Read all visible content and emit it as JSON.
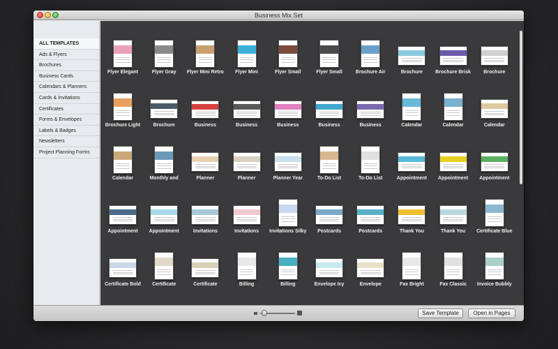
{
  "window": {
    "title": "Business Mix Set"
  },
  "sidebar": {
    "items": [
      {
        "label": "ALL TEMPLATES",
        "active": true
      },
      {
        "label": "Ads & Flyers"
      },
      {
        "label": "Brochures"
      },
      {
        "label": "Business Cards"
      },
      {
        "label": "Calendars & Planners"
      },
      {
        "label": "Cards & Invitations"
      },
      {
        "label": "Certificates"
      },
      {
        "label": "Forms & Envelopes"
      },
      {
        "label": "Labels & Badges"
      },
      {
        "label": "Newsletters"
      },
      {
        "label": "Project Planning Forms"
      }
    ]
  },
  "templates": [
    {
      "label": "Flyer Elegant",
      "shape": "portrait",
      "accent": "#e9a0b8"
    },
    {
      "label": "Flyer Gray",
      "shape": "portrait",
      "accent": "#8a8a8a"
    },
    {
      "label": "Flyer Mini Retro",
      "shape": "portrait",
      "accent": "#c8a070"
    },
    {
      "label": "Flyer Mini",
      "shape": "portrait",
      "accent": "#3db0d8"
    },
    {
      "label": "Flyer Small",
      "shape": "portrait",
      "accent": "#7a4a3a"
    },
    {
      "label": "Flyer Small",
      "shape": "portrait",
      "accent": "#4a4a4a"
    },
    {
      "label": "Brochure Air",
      "shape": "portrait",
      "accent": "#6aa0c8"
    },
    {
      "label": "Brochure",
      "shape": "landscape",
      "accent": "#8ac8e0"
    },
    {
      "label": "Brochure Brisk",
      "shape": "landscape",
      "accent": "#6a5aa8"
    },
    {
      "label": "Brochure",
      "shape": "landscape",
      "accent": "#d0d0d0"
    },
    {
      "label": "Brochure Light",
      "shape": "portrait",
      "accent": "#e8a060"
    },
    {
      "label": "Brochure",
      "shape": "landscape",
      "accent": "#4a5a68"
    },
    {
      "label": "Business",
      "shape": "card",
      "accent": "#d84040"
    },
    {
      "label": "Business",
      "shape": "card",
      "accent": "#5a5a5a"
    },
    {
      "label": "Business",
      "shape": "card",
      "accent": "#e080c0"
    },
    {
      "label": "Business",
      "shape": "card",
      "accent": "#40a8d0"
    },
    {
      "label": "Business",
      "shape": "card",
      "accent": "#7a6ab0"
    },
    {
      "label": "Calendar",
      "shape": "portrait",
      "accent": "#68b8d8"
    },
    {
      "label": "Calendar",
      "shape": "portrait",
      "accent": "#7ab0d0"
    },
    {
      "label": "Calendar",
      "shape": "landscape",
      "accent": "#e0c8a0"
    },
    {
      "label": "Calendar",
      "shape": "portrait",
      "accent": "#c8a878"
    },
    {
      "label": "Monthly and",
      "shape": "portrait",
      "accent": "#6a9ab8"
    },
    {
      "label": "Planner",
      "shape": "landscape",
      "accent": "#e8d0b0"
    },
    {
      "label": "Planner",
      "shape": "landscape",
      "accent": "#d8d0c0"
    },
    {
      "label": "Planner Year",
      "shape": "landscape",
      "accent": "#c8e0f0"
    },
    {
      "label": "To-Do List",
      "shape": "portrait",
      "accent": "#d8b890"
    },
    {
      "label": "To-Do List",
      "shape": "portrait",
      "accent": "#e0e0e0"
    },
    {
      "label": "Appointment",
      "shape": "landscape",
      "accent": "#58b8d8"
    },
    {
      "label": "Appointment",
      "shape": "landscape",
      "accent": "#e8d020"
    },
    {
      "label": "Appointment",
      "shape": "landscape",
      "accent": "#58b060"
    },
    {
      "label": "Appointment",
      "shape": "landscape",
      "accent": "#4a6a88"
    },
    {
      "label": "Appointment",
      "shape": "landscape",
      "accent": "#a8d8e8"
    },
    {
      "label": "Invitations",
      "shape": "landscape",
      "accent": "#a8c8d8"
    },
    {
      "label": "Invitations",
      "shape": "landscape",
      "accent": "#f0c8d0"
    },
    {
      "label": "Invitations Silky",
      "shape": "portrait",
      "accent": "#c8d8f0"
    },
    {
      "label": "Postcards",
      "shape": "landscape",
      "accent": "#7aa8c8"
    },
    {
      "label": "Postcards",
      "shape": "landscape",
      "accent": "#58b0c8"
    },
    {
      "label": "Thank You",
      "shape": "landscape",
      "accent": "#f0c030"
    },
    {
      "label": "Thank You",
      "shape": "landscape",
      "accent": "#b8d8e0"
    },
    {
      "label": "Certificate Blue",
      "shape": "portrait",
      "accent": "#8ab8d0"
    },
    {
      "label": "Certificate Bold",
      "shape": "landscape",
      "accent": "#c8d8e8"
    },
    {
      "label": "Certificate",
      "shape": "portrait",
      "accent": "#e0d8c8"
    },
    {
      "label": "Certificate",
      "shape": "landscape",
      "accent": "#d8d0b8"
    },
    {
      "label": "Billing",
      "shape": "portrait",
      "accent": "#e8e8e8"
    },
    {
      "label": "Billing",
      "shape": "portrait",
      "accent": "#48b0c0"
    },
    {
      "label": "Envelope Icy",
      "shape": "landscape",
      "accent": "#c8e8f0"
    },
    {
      "label": "Envelope",
      "shape": "landscape",
      "accent": "#e8e0c8"
    },
    {
      "label": "Fax Bright",
      "shape": "portrait",
      "accent": "#e8e8e8"
    },
    {
      "label": "Fax Classic",
      "shape": "portrait",
      "accent": "#e0e0e0"
    },
    {
      "label": "Invoice Bubbly",
      "shape": "portrait",
      "accent": "#a8d0c8"
    },
    {
      "label": "",
      "shape": "portrait",
      "accent": "#e8e8e8"
    },
    {
      "label": "",
      "shape": "portrait",
      "accent": "#a8d8e8"
    },
    {
      "label": "",
      "shape": "portrait",
      "accent": "#88b0d0"
    },
    {
      "label": "",
      "shape": "portrait",
      "accent": "#6a8ab0"
    },
    {
      "label": "",
      "shape": "portrait",
      "accent": "#58b8d0"
    },
    {
      "label": "",
      "shape": "portrait",
      "accent": "#e8e8e8"
    },
    {
      "label": "",
      "shape": "portrait",
      "accent": "#e0e0e0"
    },
    {
      "label": "",
      "shape": "portrait",
      "accent": "#e8a090"
    },
    {
      "label": "",
      "shape": "portrait",
      "accent": "#e0e0e0"
    },
    {
      "label": "",
      "shape": "portrait",
      "accent": "#c8c8c8"
    }
  ],
  "bottombar": {
    "save_label": "Save Template",
    "open_label": "Open in Pages",
    "zoom_icon_small": "small-thumbnail-icon",
    "zoom_icon_large": "large-thumbnail-icon"
  }
}
